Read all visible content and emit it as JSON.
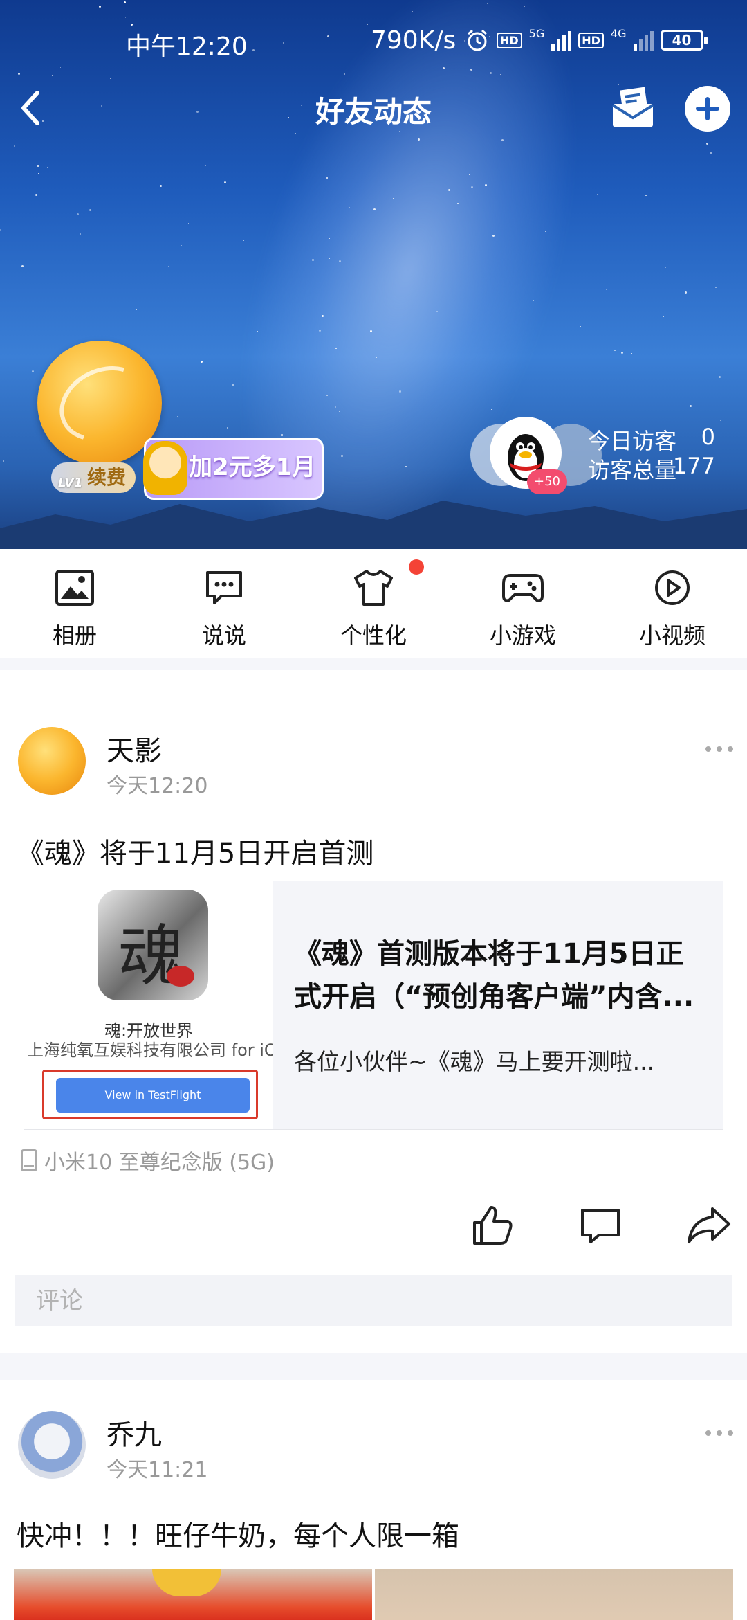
{
  "status_bar": {
    "time": "中午12:20",
    "speed": "790K/s",
    "net1": "5G",
    "net2": "4G",
    "hd": "HD",
    "battery": "40"
  },
  "nav": {
    "title": "好友动态"
  },
  "profile": {
    "vip_level": "LV1",
    "vip_label": "续费",
    "promo_text": "加2元多1月",
    "visitor_badge": "+50",
    "today_visitors_label": "今日访客",
    "today_visitors_value": "0",
    "total_visitors_label": "访客总量",
    "total_visitors_value": "177"
  },
  "shortcuts": [
    {
      "label": "相册",
      "icon": "photo-album-icon"
    },
    {
      "label": "说说",
      "icon": "chat-bubble-icon"
    },
    {
      "label": "个性化",
      "icon": "tshirt-icon"
    },
    {
      "label": "小游戏",
      "icon": "gamepad-icon"
    },
    {
      "label": "小视频",
      "icon": "play-circle-icon"
    }
  ],
  "posts": [
    {
      "author": "天影",
      "time": "今天12:20",
      "text": "《魂》将于11月5日开启首测",
      "share": {
        "thumb_app_name": "魂:开放世界",
        "thumb_company": "上海纯氧互娱科技有限公司 for iOS",
        "thumb_button": "View in TestFlight",
        "thumb_icon_char": "魂",
        "title": "《魂》首测版本将于11月5日正式开启（“预创角客户端”内含...",
        "desc": "各位小伙伴~《魂》马上要开测啦..."
      },
      "device": "小米10 至尊纪念版 (5G)",
      "comment_placeholder": "评论"
    },
    {
      "author": "乔九",
      "time": "今天11:21",
      "text": "快冲！！！旺仔牛奶，每个人限一箱"
    }
  ],
  "colors": {
    "accent": "#1f5cbc",
    "badge_red": "#f44336",
    "promo_purple": "#b99bf7"
  }
}
